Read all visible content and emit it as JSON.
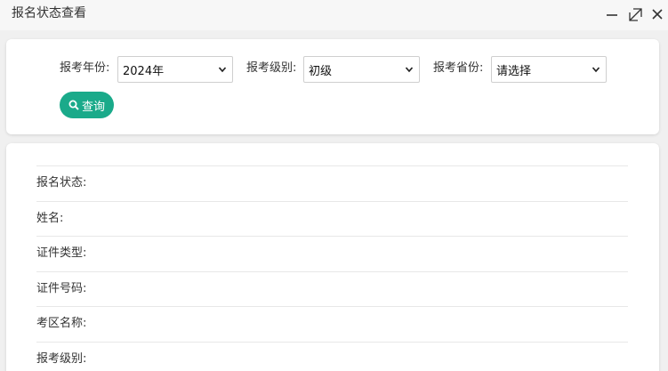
{
  "window": {
    "title": "报名状态查看"
  },
  "search": {
    "year_label": "报考年份:",
    "year_value": "2024年",
    "level_label": "报考级别:",
    "level_value": "初级",
    "province_label": "报考省份:",
    "province_value": "请选择",
    "query_label": "查询"
  },
  "results": {
    "rows": [
      {
        "label": "报名状态:"
      },
      {
        "label": "姓名:"
      },
      {
        "label": "证件类型:"
      },
      {
        "label": "证件号码:"
      },
      {
        "label": "考区名称:"
      },
      {
        "label": "报考级别:"
      }
    ]
  },
  "colors": {
    "accent": "#1aaa8a",
    "background": "#f0f0f0",
    "card": "#ffffff"
  }
}
